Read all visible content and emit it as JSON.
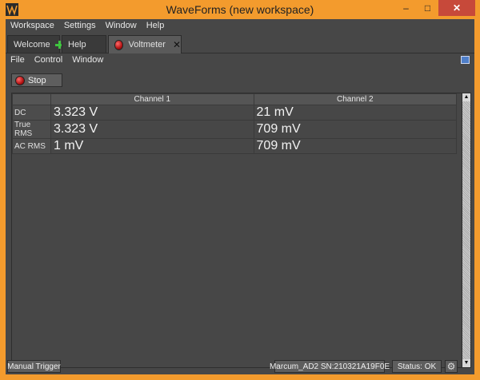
{
  "window": {
    "title": "WaveForms  (new workspace)",
    "controls": {
      "minimize": "–",
      "maximize": "□",
      "close": "✕"
    }
  },
  "menubar": {
    "items": [
      {
        "label": "Workspace",
        "mnemonic": "k"
      },
      {
        "label": "Settings",
        "mnemonic": "S"
      },
      {
        "label": "Window",
        "mnemonic": "W"
      },
      {
        "label": "Help",
        "mnemonic": "H"
      }
    ]
  },
  "tabs": [
    {
      "label": "Welcome",
      "icon": "plus-icon"
    },
    {
      "label": "Help"
    },
    {
      "label": "Voltmeter",
      "icon": "record-icon",
      "active": true
    }
  ],
  "submenu": {
    "items": [
      {
        "label": "File",
        "mnemonic": "F"
      },
      {
        "label": "Control",
        "mnemonic": "C"
      },
      {
        "label": "Window",
        "mnemonic": "W"
      }
    ]
  },
  "toolbar": {
    "stop_label": "Stop"
  },
  "table": {
    "columns": [
      "Channel 1",
      "Channel 2"
    ],
    "rows": [
      {
        "label": "DC",
        "ch1": "3.323 V",
        "ch2": "21 mV"
      },
      {
        "label": "True RMS",
        "ch1": "3.323 V",
        "ch2": "709 mV"
      },
      {
        "label": "AC RMS",
        "ch1": "1 mV",
        "ch2": "709 mV"
      }
    ]
  },
  "statusbar": {
    "manual_trigger": "Manual Trigger",
    "device": "Marcum_AD2 SN:210321A19F0E",
    "status": "Status: OK"
  },
  "colors": {
    "accent": "#f39b2d",
    "panel": "#474747",
    "close": "#c7493a"
  }
}
